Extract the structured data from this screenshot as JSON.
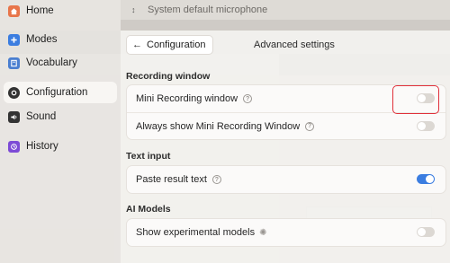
{
  "sidebar": {
    "items": [
      {
        "label": "Home",
        "icon": "home-icon",
        "color": "#e8754a",
        "active": false
      },
      {
        "label": "Modes",
        "icon": "plus-icon",
        "color": "#3b7de0",
        "active": false
      },
      {
        "label": "Vocabulary",
        "icon": "book-icon",
        "color": "#4a7fd0",
        "active": false
      },
      {
        "label": "Configuration",
        "icon": "gear-icon",
        "color": "#333333",
        "active": true
      },
      {
        "label": "Sound",
        "icon": "speaker-icon",
        "color": "#333333",
        "active": false
      },
      {
        "label": "History",
        "icon": "history-icon",
        "color": "#7d4bd6",
        "active": false
      }
    ]
  },
  "mic": {
    "label": "System default microphone"
  },
  "header": {
    "back_label": "Configuration",
    "advanced_label": "Advanced settings"
  },
  "sections": {
    "recording": {
      "title": "Recording window",
      "mini_label": "Mini Recording window",
      "mini_on": false,
      "always_label": "Always show Mini Recording Window",
      "always_on": false
    },
    "text_input": {
      "title": "Text input",
      "paste_label": "Paste result text",
      "paste_on": true
    },
    "ai_models": {
      "title": "AI Models",
      "experimental_label": "Show experimental models",
      "experimental_on": false
    }
  },
  "colors": {
    "accent": "#3b7de0",
    "highlight": "#e0303a"
  }
}
